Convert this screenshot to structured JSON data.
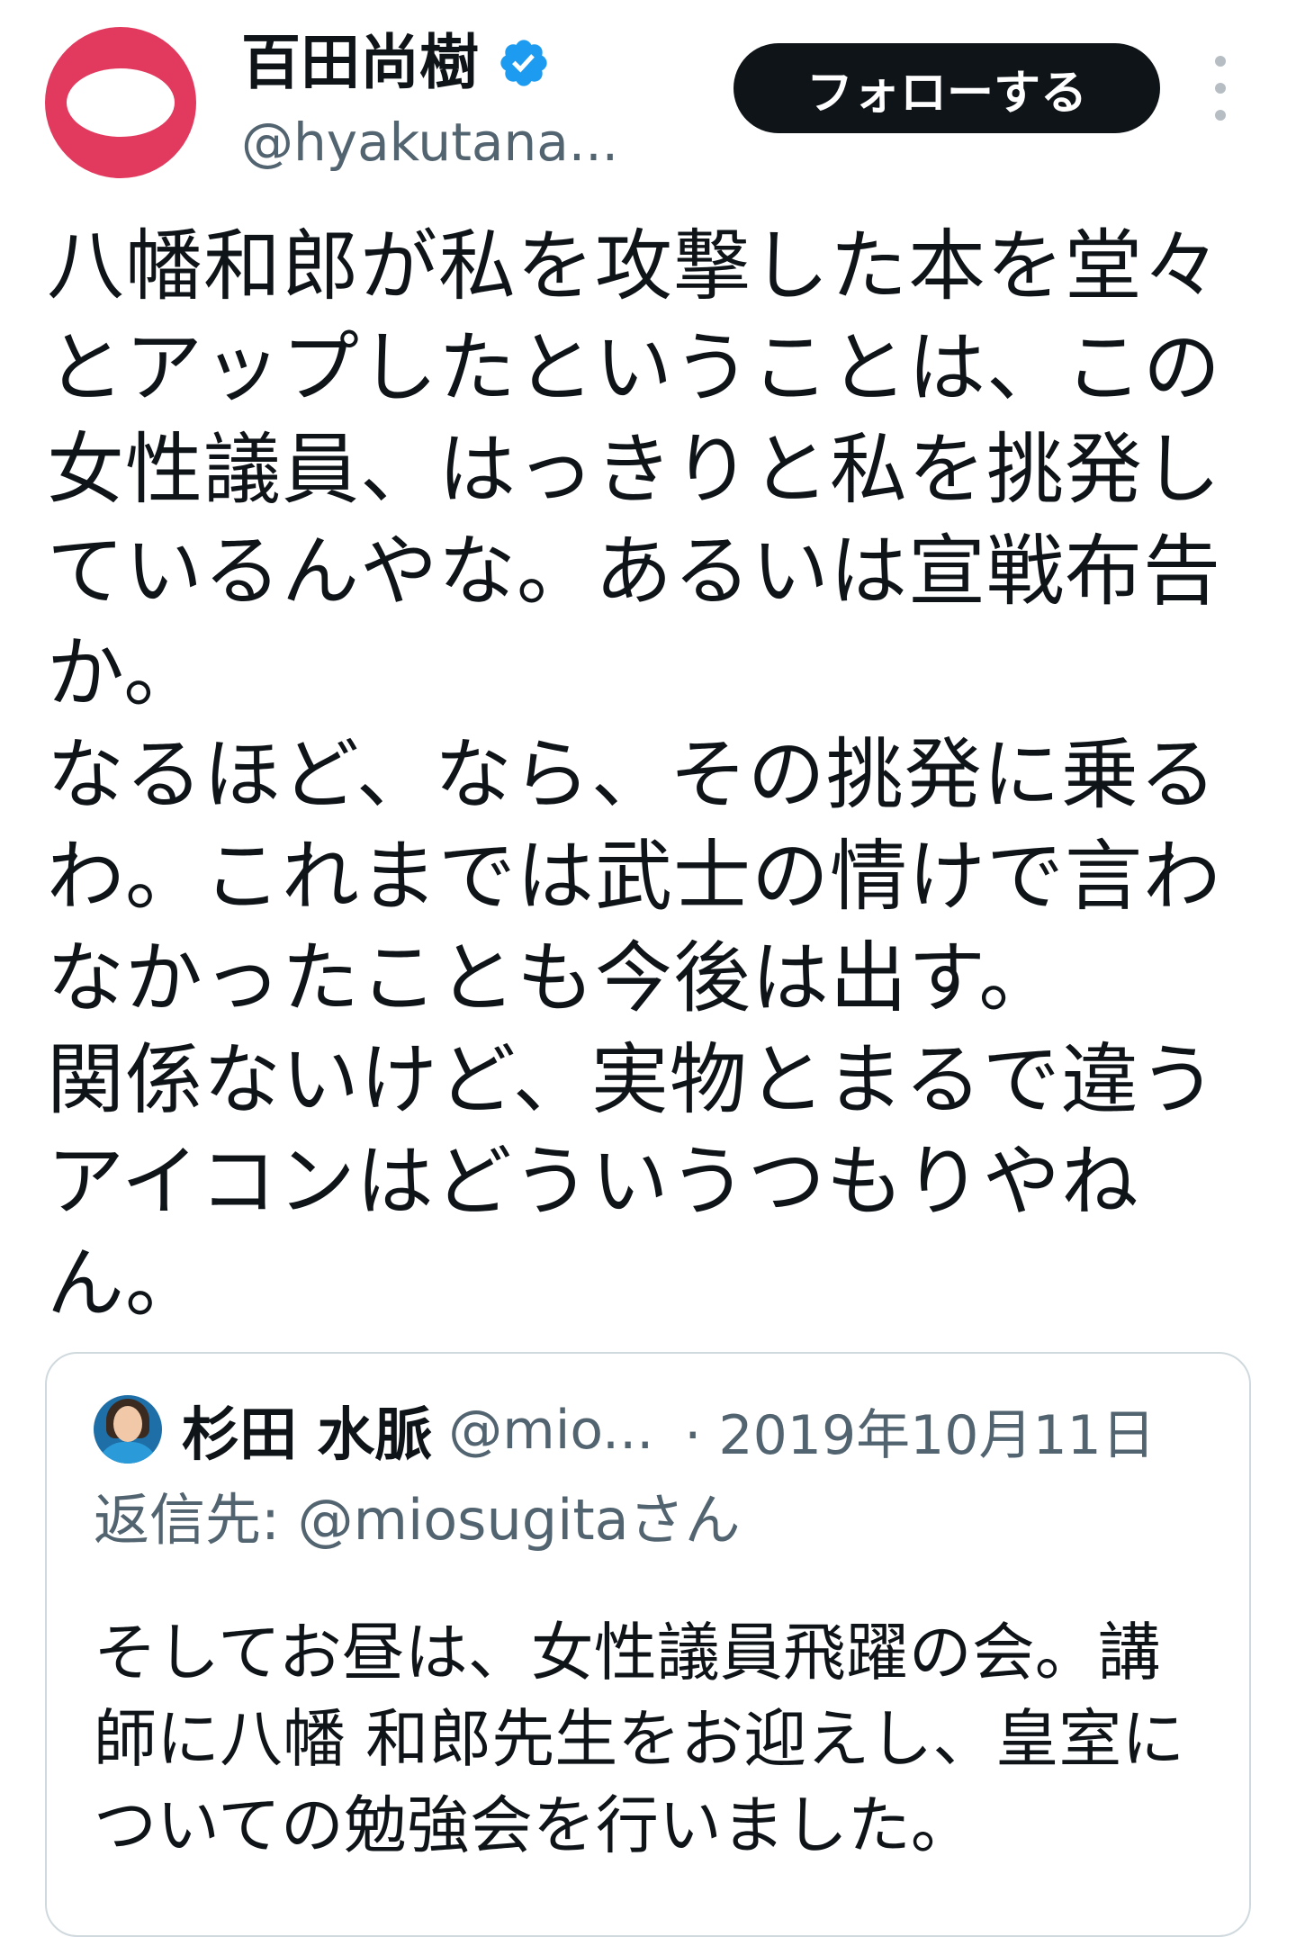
{
  "author": {
    "name": "百田尚樹",
    "handle": "@hyakutana...",
    "verified_icon": "verified-badge-icon",
    "avatar_color": "#e23a5e",
    "verified_color": "#1d9bf0"
  },
  "actions": {
    "follow_label": "フォローする",
    "more_icon": "more-vertical-icon"
  },
  "tweet": {
    "lines": [
      "八幡和郎が私を攻撃した本を堂々",
      "とアップしたということは、この",
      "女性議員、はっきりと私を挑発し",
      "ているんやな。あるいは宣戦布告",
      "か。",
      "なるほど、なら、その挑発に乗る",
      "わ。これまでは武士の情けで言わ",
      "なかったことも今後は出す。",
      "関係ないけど、実物とまるで違う",
      "アイコンはどういうつもりやね",
      "ん。"
    ]
  },
  "quote": {
    "name": "杉田 水脈",
    "handle": "@mio...",
    "date": "· 2019年10月11日",
    "reply_to": "返信先: @miosugitaさん",
    "lines": [
      "そしてお昼は、女性議員飛躍の会。講",
      "師に八幡 和郎先生をお迎えし、皇室に",
      "ついての勉強会を行いました。"
    ]
  }
}
